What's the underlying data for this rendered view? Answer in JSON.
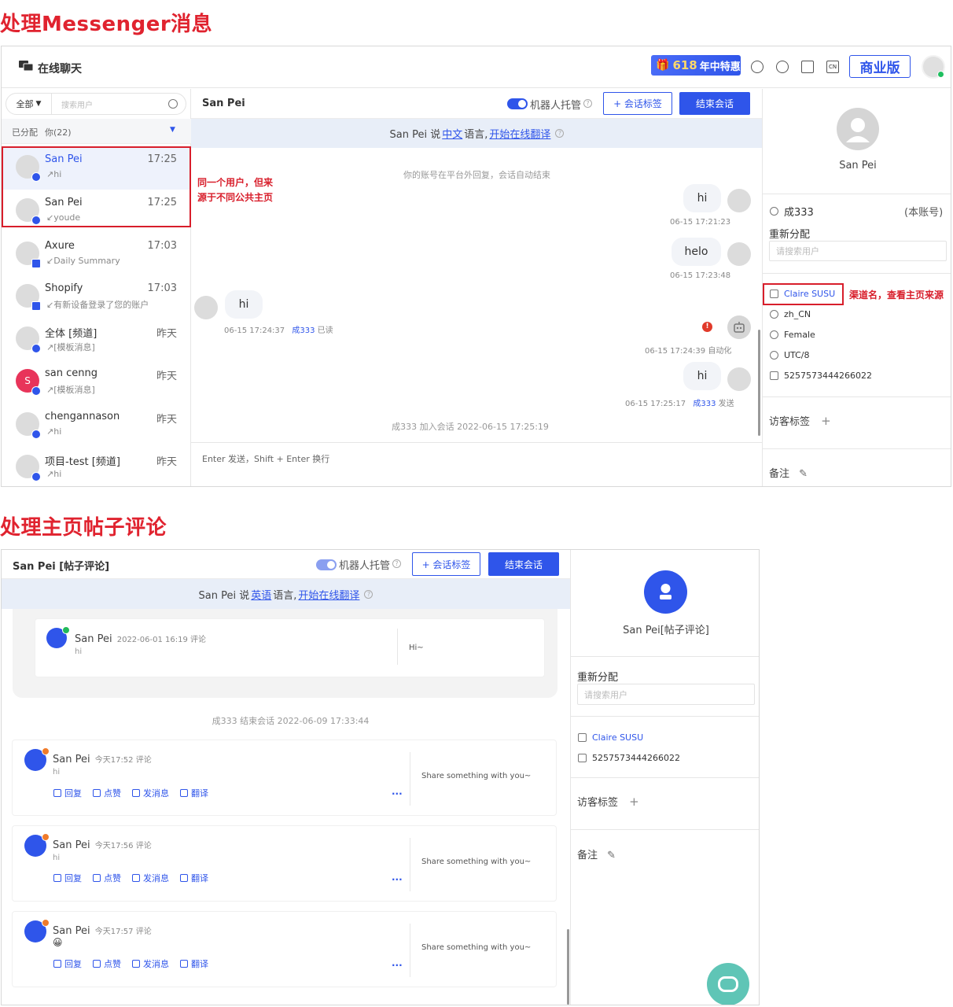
{
  "section1": {
    "title": "处理Messenger消息"
  },
  "section2": {
    "title": "处理主页帖子评论"
  },
  "topbar": {
    "app_title": "在线聊天",
    "promo_number": "618",
    "promo_text": "年中特惠",
    "biz_button": "商业版"
  },
  "left": {
    "filter_label": "全部",
    "search_placeholder": "搜索用户",
    "assigned_label": "已分配",
    "assigned_count": "你(22)",
    "items": [
      {
        "name": "San Pei",
        "time": "17:25",
        "sub": "↗hi"
      },
      {
        "name": "San Pei",
        "time": "17:25",
        "sub": "↙youde"
      },
      {
        "name": "Axure",
        "time": "17:03",
        "sub": "↙Daily Summary"
      },
      {
        "name": "Shopify",
        "time": "17:03",
        "sub": "↙有新设备登录了您的账户"
      },
      {
        "name": "全体 [频道]",
        "time": "昨天",
        "sub": "↗[模板消息]"
      },
      {
        "name": "san cenng",
        "time": "昨天",
        "sub": "↗[模板消息]",
        "avatar_letter": "S"
      },
      {
        "name": "chengannason",
        "time": "昨天",
        "sub": "↗hi"
      },
      {
        "name": "项目-test [频道]",
        "time": "昨天",
        "sub": "↗hi"
      }
    ]
  },
  "chat1": {
    "user": "San Pei",
    "robot_label": "机器人托管",
    "tag_button": "+ 会话标签",
    "end_button": "结束会话",
    "trans_prefix": "San Pei 说",
    "trans_lang": "中文",
    "trans_mid": "语言,",
    "trans_link": "开始在线翻译",
    "sys1": "你的账号在平台外回复，会话自动结束",
    "messages": [
      {
        "text": "hi",
        "meta": "06-15 17:21:23"
      },
      {
        "text": "helo",
        "meta": "06-15 17:23:48"
      },
      {
        "text": "hi",
        "meta": "06-15 17:24:37",
        "agent": "成333",
        "status": "已读"
      },
      {
        "meta": "06-15 17:24:39 自动化"
      },
      {
        "text": "hi",
        "meta": "06-15 17:25:17",
        "agent": "成333",
        "status": "发送"
      }
    ],
    "sys2": "成333 加入会话 2022-06-15 17:25:19",
    "input_hint": "Enter 发送，Shift + Enter 换行"
  },
  "right1": {
    "profile_name": "San Pei",
    "account": "成333",
    "account_note": "(本账号)",
    "reassign_label": "重新分配",
    "reassign_placeholder": "请搜索用户",
    "channel": "Claire SUSU",
    "locale": "zh_CN",
    "gender": "Female",
    "timezone": "UTC/8",
    "id": "5257573444266022",
    "visitor_tag": "访客标签",
    "note": "备注"
  },
  "annotations": {
    "same_user": "同一个用户，但来源于不同公共主页",
    "channel": "渠道名，查看主页来源"
  },
  "chat2": {
    "user": "San Pei [帖子评论]",
    "robot_label": "机器人托管",
    "tag_button": "+ 会话标签",
    "end_button": "结束会话",
    "trans_prefix": "San Pei 说",
    "trans_lang": "英语",
    "trans_mid": "语言,",
    "trans_link": "开始在线翻译",
    "post": {
      "name": "San Pei",
      "meta": "2022-06-01 16:19 评论",
      "text": "hi",
      "reply": "Hi~"
    },
    "sys": "成333 结束会话 2022-06-09 17:33:44",
    "comments": [
      {
        "name": "San Pei",
        "meta": "今天17:52 评论",
        "text": "hi",
        "post": "Share something with you~"
      },
      {
        "name": "San Pei",
        "meta": "今天17:56 评论",
        "text": "hi",
        "post": "Share something with you~"
      },
      {
        "name": "San Pei",
        "meta": "今天17:57 评论",
        "text": "😀",
        "post": "Share something with you~"
      }
    ],
    "actions": {
      "reply": "回复",
      "like": "点赞",
      "message": "发消息",
      "translate": "翻译",
      "more": "..."
    }
  },
  "right2": {
    "profile_name": "San Pei[帖子评论]",
    "reassign_label": "重新分配",
    "reassign_placeholder": "请搜索用户",
    "channel": "Claire SUSU",
    "id": "5257573444266022",
    "visitor_tag": "访客标签",
    "note": "备注"
  },
  "colors": {
    "accent": "#2f55ea",
    "red": "#d81e2b",
    "title_red": "#e0232f"
  }
}
